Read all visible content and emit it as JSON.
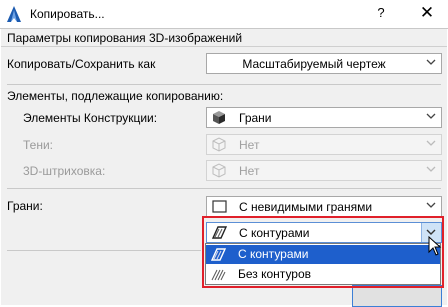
{
  "window": {
    "title": "Копировать..."
  },
  "titlebar": {
    "help_label": "?",
    "close_label": "✕"
  },
  "header": {
    "text": "Параметры копирования 3D-изображений"
  },
  "copy_as": {
    "label": "Копировать/Сохранить как",
    "value": "Масштабируемый чертеж"
  },
  "elements_section": {
    "label": "Элементы, подлежащие копированию:"
  },
  "construction": {
    "label": "Элементы Конструкции:",
    "value": "Грани",
    "icon": "solid-cube-icon"
  },
  "shadows": {
    "label": "Тени:",
    "value": "Нет",
    "icon": "wireframe-cube-icon"
  },
  "hatching": {
    "label": "3D-штриховка:",
    "value": "Нет",
    "icon": "wireframe-cube-icon"
  },
  "faces": {
    "label": "Грани:",
    "value": "С невидимыми гранями",
    "icon": "square-icon"
  },
  "contour": {
    "value": "С контурами",
    "options": [
      {
        "label": "С контурами",
        "icon": "hatched-outlined-icon",
        "selected": true
      },
      {
        "label": "Без контуров",
        "icon": "hatched-no-outline-icon",
        "selected": false
      }
    ]
  },
  "colors": {
    "highlight": "#1e5fcc",
    "callout": "#e0202a",
    "disabled_text": "#9a9a9a"
  }
}
